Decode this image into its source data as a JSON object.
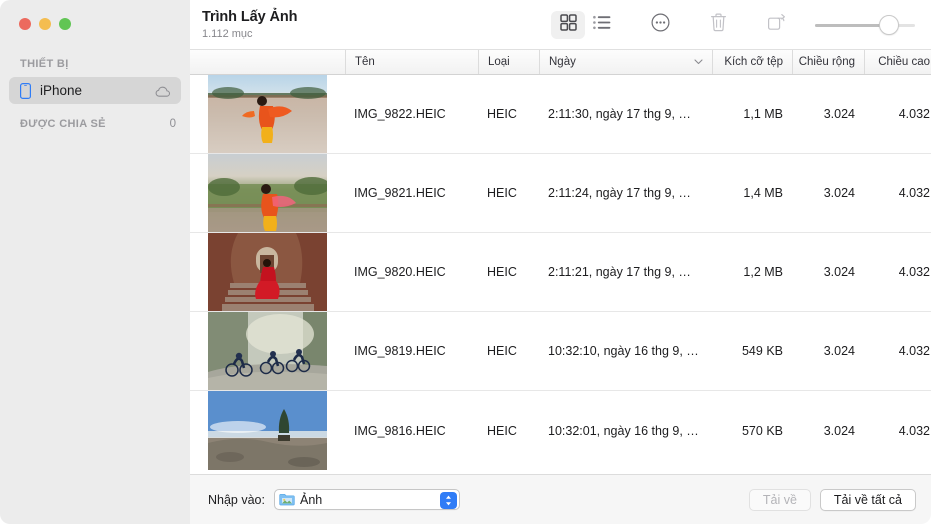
{
  "window": {
    "traffic_lights": [
      {
        "name": "close",
        "color": "#ec6a5e"
      },
      {
        "name": "minimize",
        "color": "#f4bd50"
      },
      {
        "name": "zoom",
        "color": "#61c554"
      }
    ]
  },
  "sidebar": {
    "devices_header": "THIẾT BỊ",
    "devices": [
      {
        "label": "iPhone",
        "icon": "iphone-icon",
        "trailing_icon": "cloud-icon",
        "selected": true
      }
    ],
    "shared_header": "ĐƯỢC CHIA SẺ",
    "shared_count": "0"
  },
  "toolbar": {
    "title": "Trình Lấy Ảnh",
    "subtitle": "1.112 mục",
    "buttons": [
      {
        "name": "grid-view-icon",
        "label": "Dạng lưới",
        "active": true
      },
      {
        "name": "list-view-icon",
        "label": "Dạng danh sách",
        "active": false
      },
      {
        "name": "more-options-icon",
        "label": "Thêm",
        "active": false
      },
      {
        "name": "trash-icon",
        "label": "Xóa",
        "active": false
      },
      {
        "name": "rotate-icon",
        "label": "Xoay",
        "active": false
      }
    ],
    "zoom_slider": {
      "name": "thumbnail-size-slider",
      "value": 83
    }
  },
  "table": {
    "columns": [
      {
        "key": "thumb",
        "label": ""
      },
      {
        "key": "name",
        "label": "Tên"
      },
      {
        "key": "type",
        "label": "Loại"
      },
      {
        "key": "date",
        "label": "Ngày",
        "sorted": true,
        "sort_icon": "chevron-down-icon"
      },
      {
        "key": "size",
        "label": "Kích cỡ tệp"
      },
      {
        "key": "width",
        "label": "Chiều rộng"
      },
      {
        "key": "height",
        "label": "Chiều cao"
      }
    ],
    "rows": [
      {
        "name": "IMG_9822.HEIC",
        "type": "HEIC",
        "date": "2:11:30, ngày 17 thg 9, …",
        "size": "1,1 MB",
        "width": "3.024",
        "height": "4.032",
        "thumb": "woman-red-sari-on-terrace"
      },
      {
        "name": "IMG_9821.HEIC",
        "type": "HEIC",
        "date": "2:11:24, ngày 17 thg 9, …",
        "size": "1,4 MB",
        "width": "3.024",
        "height": "4.032",
        "thumb": "woman-red-sari-garden-view"
      },
      {
        "name": "IMG_9820.HEIC",
        "type": "HEIC",
        "date": "2:11:21, ngày 17 thg 9, …",
        "size": "1,2 MB",
        "width": "3.024",
        "height": "4.032",
        "thumb": "woman-red-dress-stone-stairs"
      },
      {
        "name": "IMG_9819.HEIC",
        "type": "HEIC",
        "date": "10:32:10, ngày 16 thg 9, …",
        "size": "549 KB",
        "width": "3.024",
        "height": "4.032",
        "thumb": "cyclists-misty-forest-road"
      },
      {
        "name": "IMG_9816.HEIC",
        "type": "HEIC",
        "date": "10:32:01, ngày 16 thg 9, …",
        "size": "570 KB",
        "width": "3.024",
        "height": "4.032",
        "thumb": "mountain-ridge-lone-tree"
      }
    ]
  },
  "bottom_bar": {
    "import_label": "Nhập vào:",
    "destination": {
      "icon": "photos-folder-icon",
      "value": "Ảnh"
    },
    "download_button": {
      "label": "Tải về",
      "disabled": true
    },
    "download_all_button": {
      "label": "Tải về tất cả",
      "disabled": false
    }
  },
  "colors": {
    "sidebar_bg": "#ececec",
    "selection_bg": "#d6d6d6",
    "accent_blue": "#2f7cf6",
    "text_primary": "#1d1d1f",
    "text_secondary": "#86868b"
  }
}
